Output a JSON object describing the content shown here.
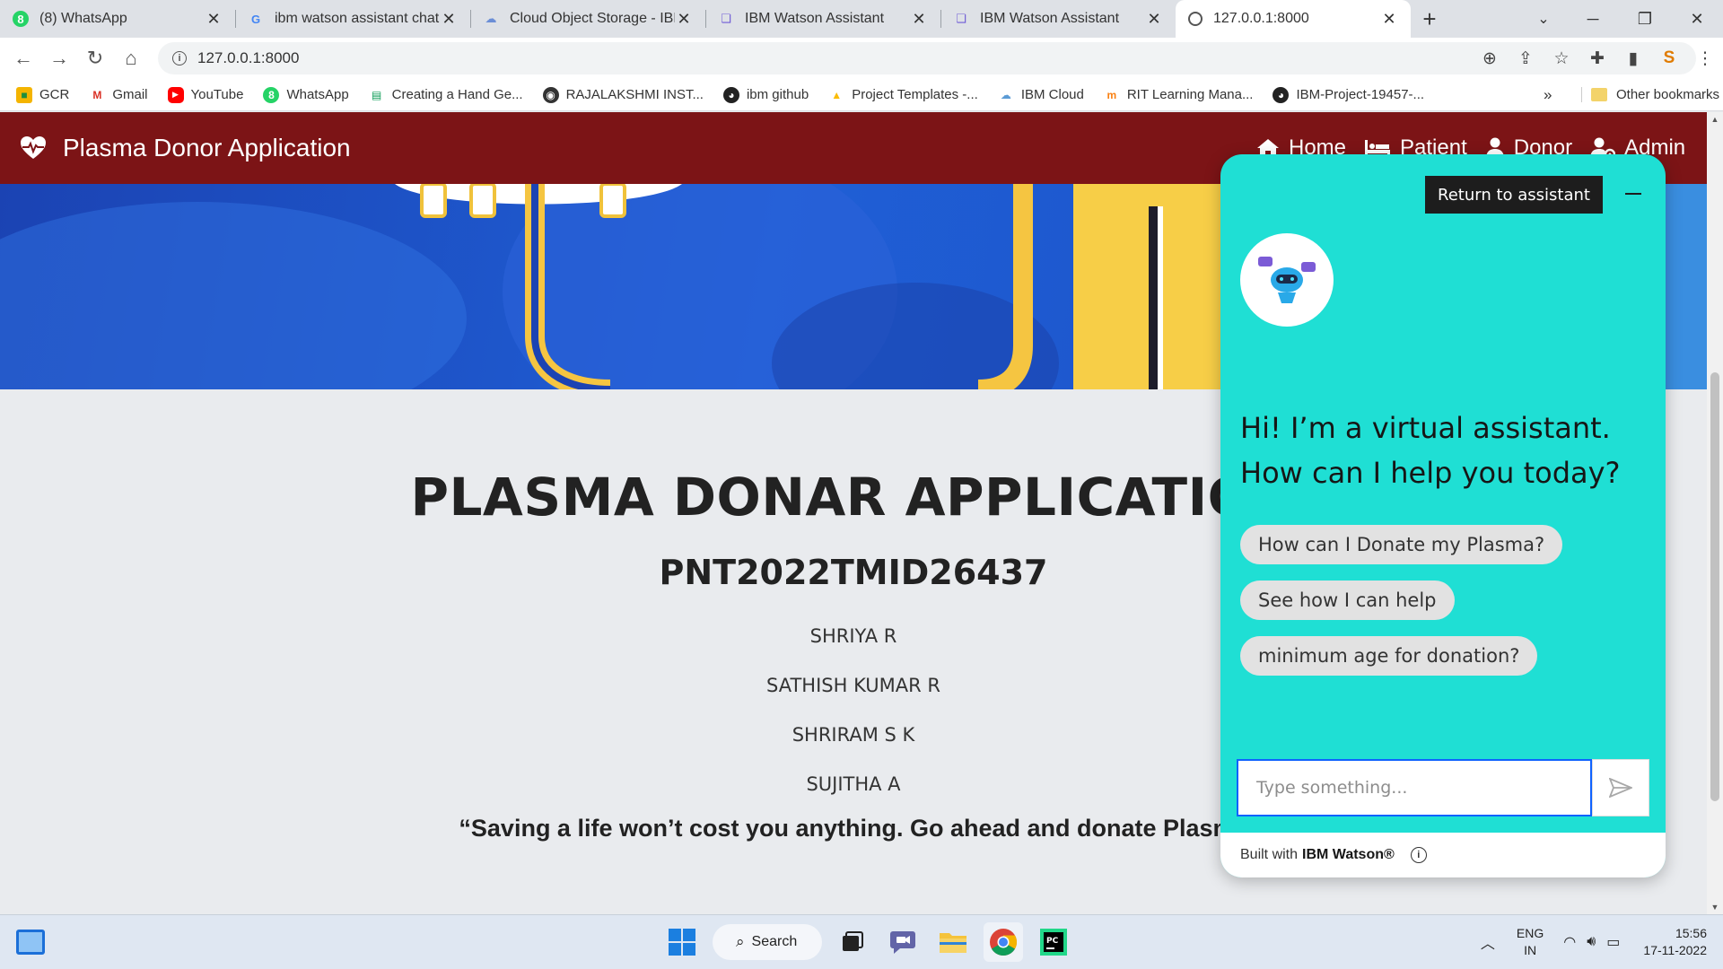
{
  "browser": {
    "tabs": [
      {
        "title": "(8) WhatsApp",
        "icon": "whatsapp-icon"
      },
      {
        "title": "ibm watson assistant chatbot",
        "icon": "google-icon"
      },
      {
        "title": "Cloud Object Storage - IBM",
        "icon": "cloud-icon"
      },
      {
        "title": "IBM Watson Assistant",
        "icon": "watson-icon"
      },
      {
        "title": "IBM Watson Assistant",
        "icon": "watson-icon"
      },
      {
        "title": "127.0.0.1:8000",
        "icon": "globe-icon",
        "active": true
      }
    ],
    "url": "127.0.0.1:8000",
    "bookmarks": [
      {
        "label": "GCR",
        "icon": "classroom-icon"
      },
      {
        "label": "Gmail",
        "icon": "gmail-icon"
      },
      {
        "label": "YouTube",
        "icon": "youtube-icon"
      },
      {
        "label": "WhatsApp",
        "icon": "whatsapp-icon"
      },
      {
        "label": "Creating a Hand Ge...",
        "icon": "doc-icon"
      },
      {
        "label": "RAJALAKSHMI INST...",
        "icon": "globe-icon"
      },
      {
        "label": "ibm github",
        "icon": "github-icon"
      },
      {
        "label": "Project Templates -...",
        "icon": "drive-icon"
      },
      {
        "label": "IBM Cloud",
        "icon": "cloud-icon"
      },
      {
        "label": "RIT Learning Mana...",
        "icon": "moodle-icon"
      },
      {
        "label": "IBM-Project-19457-...",
        "icon": "github-icon"
      }
    ],
    "bookmarks_more": "»",
    "other_bookmarks": "Other bookmarks"
  },
  "site": {
    "brand": "Plasma Donor Application",
    "nav": [
      {
        "label": "Home",
        "icon": "home-icon"
      },
      {
        "label": "Patient",
        "icon": "patient-icon"
      },
      {
        "label": "Donor",
        "icon": "user-icon"
      },
      {
        "label": "Admin",
        "icon": "admin-icon"
      }
    ],
    "title": "PLASMA DONAR APPLICATION",
    "team_id": "PNT2022TMID26437",
    "members": [
      "SHRIYA R",
      "SATHISH KUMAR R",
      "SHRIRAM S K",
      "SUJITHA A"
    ],
    "quote": "“Saving a life won’t cost you anything. Go ahead and donate Plasma"
  },
  "chat": {
    "return_label": "Return to assistant",
    "greeting": "Hi! I’m a virtual assistant. How can I help you today?",
    "suggestions": [
      "How can I Donate my Plasma?",
      "See how I can help",
      "minimum age for donation?"
    ],
    "input_placeholder": "Type something...",
    "footer_prefix": "Built with",
    "footer_brand": "IBM Watson®",
    "accent": "#1fdfd4"
  },
  "taskbar": {
    "search_label": "Search",
    "lang_top": "ENG",
    "lang_bottom": "IN",
    "time": "15:56",
    "date": "17-11-2022"
  }
}
